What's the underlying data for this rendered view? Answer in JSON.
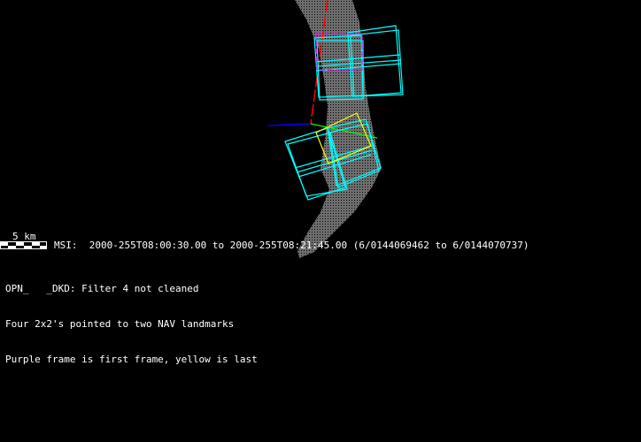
{
  "scale_bar": {
    "label": "5 km"
  },
  "header": {
    "instrument": "MSI:",
    "time_range": "2000-255T08:00:30.00 to 2000-255T08:21:45.00 (6/0144069462 to 6/0144070737)"
  },
  "notes": [
    "OPN_   _DKD: Filter 4 not cleaned",
    "Four 2x2's pointed to two NAV landmarks",
    "Purple frame is first frame, yellow is last"
  ],
  "colors": {
    "background": "#000000",
    "asteroid": "#777777",
    "frames": "#00ffff",
    "first_frame": "#ff00ff",
    "last_frame": "#ffff00",
    "axis_x": "#ff0000",
    "axis_y": "#00ff00",
    "axis_z": "#0000ff"
  }
}
